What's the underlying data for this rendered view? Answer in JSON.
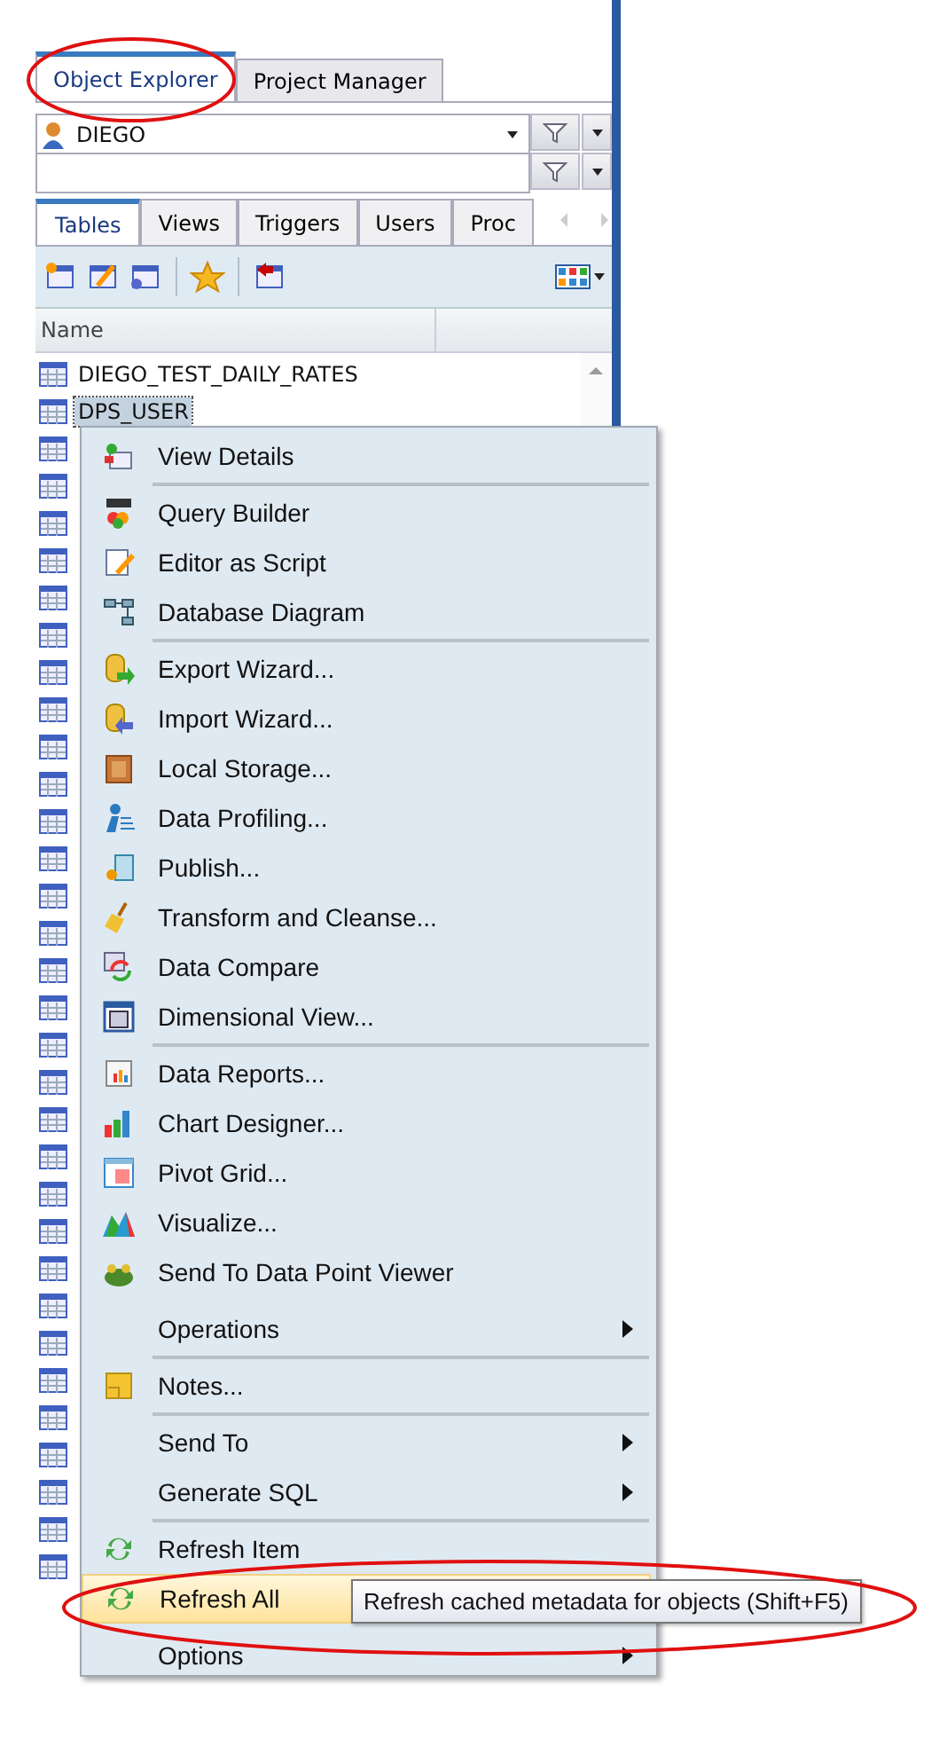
{
  "panel_tabs": [
    {
      "label": "Object Explorer",
      "selected": true
    },
    {
      "label": "Project Manager",
      "selected": false
    }
  ],
  "connection": {
    "value": "DIEGO"
  },
  "object_tabs": [
    {
      "label": "Tables",
      "selected": true
    },
    {
      "label": "Views",
      "selected": false
    },
    {
      "label": "Triggers",
      "selected": false
    },
    {
      "label": "Users",
      "selected": false
    },
    {
      "label": "Proc",
      "selected": false
    }
  ],
  "list": {
    "column": "Name",
    "rows": [
      {
        "kind": "named",
        "name": "DIEGO_TEST_DAILY_RATES",
        "selected": false
      },
      {
        "kind": "named",
        "name": "DPS_USER",
        "selected": true
      },
      {
        "kind": "covered"
      },
      {
        "kind": "covered"
      },
      {
        "kind": "covered"
      },
      {
        "kind": "covered"
      },
      {
        "kind": "covered"
      },
      {
        "kind": "covered"
      },
      {
        "kind": "covered"
      },
      {
        "kind": "covered"
      },
      {
        "kind": "covered"
      },
      {
        "kind": "covered"
      },
      {
        "kind": "covered"
      },
      {
        "kind": "covered"
      },
      {
        "kind": "covered"
      },
      {
        "kind": "covered"
      },
      {
        "kind": "covered"
      },
      {
        "kind": "covered"
      },
      {
        "kind": "covered"
      },
      {
        "kind": "covered"
      },
      {
        "kind": "covered"
      },
      {
        "kind": "covered"
      },
      {
        "kind": "covered"
      },
      {
        "kind": "covered"
      },
      {
        "kind": "covered"
      },
      {
        "kind": "covered"
      },
      {
        "kind": "covered"
      },
      {
        "kind": "covered"
      },
      {
        "kind": "covered"
      },
      {
        "kind": "covered"
      },
      {
        "kind": "covered"
      },
      {
        "kind": "covered"
      },
      {
        "kind": "covered"
      }
    ]
  },
  "context_menu": {
    "items": [
      {
        "kind": "item",
        "label": "View Details",
        "submenu": false,
        "highlighted": false
      },
      {
        "kind": "separator"
      },
      {
        "kind": "item",
        "label": "Query Builder",
        "submenu": false,
        "highlighted": false
      },
      {
        "kind": "item",
        "label": "Editor as Script",
        "submenu": false,
        "highlighted": false
      },
      {
        "kind": "item",
        "label": "Database Diagram",
        "submenu": false,
        "highlighted": false
      },
      {
        "kind": "separator"
      },
      {
        "kind": "item",
        "label": "Export Wizard...",
        "submenu": false,
        "highlighted": false
      },
      {
        "kind": "item",
        "label": "Import Wizard...",
        "submenu": false,
        "highlighted": false
      },
      {
        "kind": "item",
        "label": "Local Storage...",
        "submenu": false,
        "highlighted": false
      },
      {
        "kind": "item",
        "label": "Data Profiling...",
        "submenu": false,
        "highlighted": false
      },
      {
        "kind": "item",
        "label": "Publish...",
        "submenu": false,
        "highlighted": false
      },
      {
        "kind": "item",
        "label": "Transform and Cleanse...",
        "submenu": false,
        "highlighted": false
      },
      {
        "kind": "item",
        "label": "Data Compare",
        "submenu": false,
        "highlighted": false
      },
      {
        "kind": "item",
        "label": "Dimensional View...",
        "submenu": false,
        "highlighted": false
      },
      {
        "kind": "separator"
      },
      {
        "kind": "item",
        "label": "Data Reports...",
        "submenu": false,
        "highlighted": false
      },
      {
        "kind": "item",
        "label": "Chart Designer...",
        "submenu": false,
        "highlighted": false
      },
      {
        "kind": "item",
        "label": "Pivot Grid...",
        "submenu": false,
        "highlighted": false
      },
      {
        "kind": "item",
        "label": "Visualize...",
        "submenu": false,
        "highlighted": false
      },
      {
        "kind": "item",
        "label": "Send To Data Point Viewer",
        "submenu": false,
        "highlighted": false
      },
      {
        "kind": "item",
        "label": "Operations",
        "submenu": true,
        "highlighted": false
      },
      {
        "kind": "separator"
      },
      {
        "kind": "item",
        "label": "Notes...",
        "submenu": false,
        "highlighted": false
      },
      {
        "kind": "separator"
      },
      {
        "kind": "item",
        "label": "Send To",
        "submenu": true,
        "highlighted": false
      },
      {
        "kind": "item",
        "label": "Generate SQL",
        "submenu": true,
        "highlighted": false
      },
      {
        "kind": "separator"
      },
      {
        "kind": "item",
        "label": "Refresh Item",
        "submenu": false,
        "highlighted": false
      },
      {
        "kind": "item",
        "label": "Refresh All",
        "submenu": false,
        "highlighted": true
      },
      {
        "kind": "item",
        "label": "Options",
        "submenu": true,
        "highlighted": false
      }
    ]
  },
  "tooltip": "Refresh cached metadata for objects (Shift+F5)"
}
